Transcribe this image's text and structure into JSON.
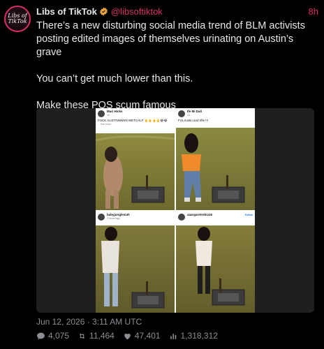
{
  "account": {
    "name": "Libs of TikTok",
    "handle": "@libsoftiktok",
    "time_ago": "8h",
    "avatar_text": "Libs of TikTok",
    "accent_color": "#d72d6b"
  },
  "tweet": {
    "paragraphs": [
      "There’s a new disturbing social media trend of BLM activists posting edited images of themselves urinating on Austin’s grave",
      "You can’t get much lower than this.",
      "Make these POS scum famous"
    ],
    "timestamp": "Jun 12, 2026 · 3:11 AM UTC"
  },
  "media": {
    "panels": [
      {
        "name": "Mari Hicks",
        "sub": "1h · ",
        "caption": "FUCK AUSTINNNNN WETCALF 🖕🖕🖕🖕😂😂",
        "more": "... See more",
        "follow": ""
      },
      {
        "name": "Ife Mi Dali",
        "sub": "1h · ",
        "caption": "Fck Austin and rifle !!!",
        "more": "",
        "follow": ""
      },
      {
        "name": "babyjunglesiah",
        "sub": "2 hours ago",
        "caption": "",
        "more": "",
        "follow": ""
      },
      {
        "name": "aaargaretrebia16",
        "sub": "",
        "caption": "",
        "more": "",
        "follow": "Follow"
      }
    ]
  },
  "stats": {
    "replies": "4,075",
    "retweets": "11,464",
    "likes": "47,401",
    "views": "1,318,312"
  },
  "icons": [
    "verified-badge-icon",
    "reply-icon",
    "retweet-icon",
    "like-icon",
    "views-icon"
  ]
}
